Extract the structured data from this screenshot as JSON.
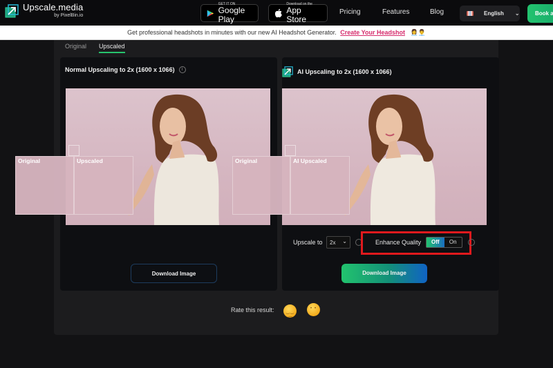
{
  "header": {
    "logo_title": "Upscale.media",
    "logo_subtitle": "by PixelBin.io",
    "google_play": {
      "small": "GET IT ON",
      "big": "Google Play"
    },
    "app_store": {
      "small": "Download on the",
      "big": "App Store"
    },
    "nav": [
      "Pricing",
      "Features",
      "Blog"
    ],
    "language": "English",
    "cta_label": "Book a"
  },
  "banner": {
    "text": "Get professional headshots in minutes with our new AI Headshot Generator.",
    "link": "Create Your Headshot",
    "emoji": "👩‍💼👨‍💼"
  },
  "tabs": [
    {
      "label": "Original",
      "active": false
    },
    {
      "label": "Upscaled",
      "active": true
    }
  ],
  "cards": {
    "normal": {
      "title": "Normal Upscaling to 2x (1600 x 1066)",
      "overlay_labels": [
        "Original",
        "Upscaled"
      ],
      "download_label": "Download Image"
    },
    "ai": {
      "title": "AI Upscaling to 2x (1600 x 1066)",
      "overlay_labels": [
        "Original",
        "AI Upscaled"
      ],
      "upscale_label": "Upscale to",
      "upscale_value": "2x",
      "enhance_label": "Enhance Quality",
      "toggle_off": "Off",
      "toggle_on": "On",
      "toggle_selected": "Off",
      "download_label": "Download Image"
    }
  },
  "rating": {
    "label": "Rate this result:",
    "options": [
      "pensive-face",
      "neutral-face"
    ]
  },
  "colors": {
    "accent_green": "#22c36e",
    "accent_blue": "#1063c4",
    "link_pink": "#d52a6b",
    "highlight_red": "#e0191d"
  }
}
